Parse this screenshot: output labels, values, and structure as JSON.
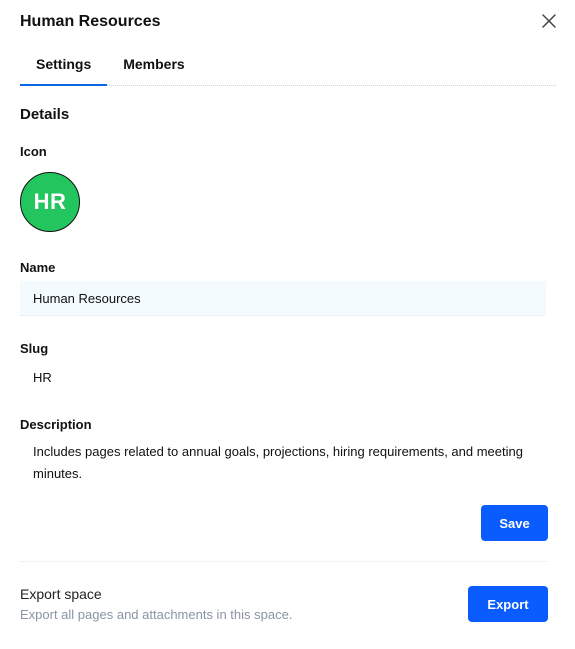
{
  "header": {
    "title": "Human Resources",
    "close_icon": "close-icon"
  },
  "tabs": [
    {
      "label": "Settings",
      "active": true
    },
    {
      "label": "Members",
      "active": false
    }
  ],
  "details": {
    "section_title": "Details",
    "icon_label": "Icon",
    "avatar_initials": "HR",
    "avatar_color": "#22c55e",
    "name_label": "Name",
    "name_value": "Human Resources",
    "slug_label": "Slug",
    "slug_value": "HR",
    "description_label": "Description",
    "description_value": "Includes pages related to annual goals, projections, hiring requirements, and meeting minutes.",
    "save_label": "Save"
  },
  "export": {
    "title": "Export space",
    "description": "Export all pages and attachments in this space.",
    "button_label": "Export"
  },
  "colors": {
    "accent": "#0b5cff",
    "tab_underline": "#0b66e4",
    "muted_text": "#8a94a6"
  }
}
